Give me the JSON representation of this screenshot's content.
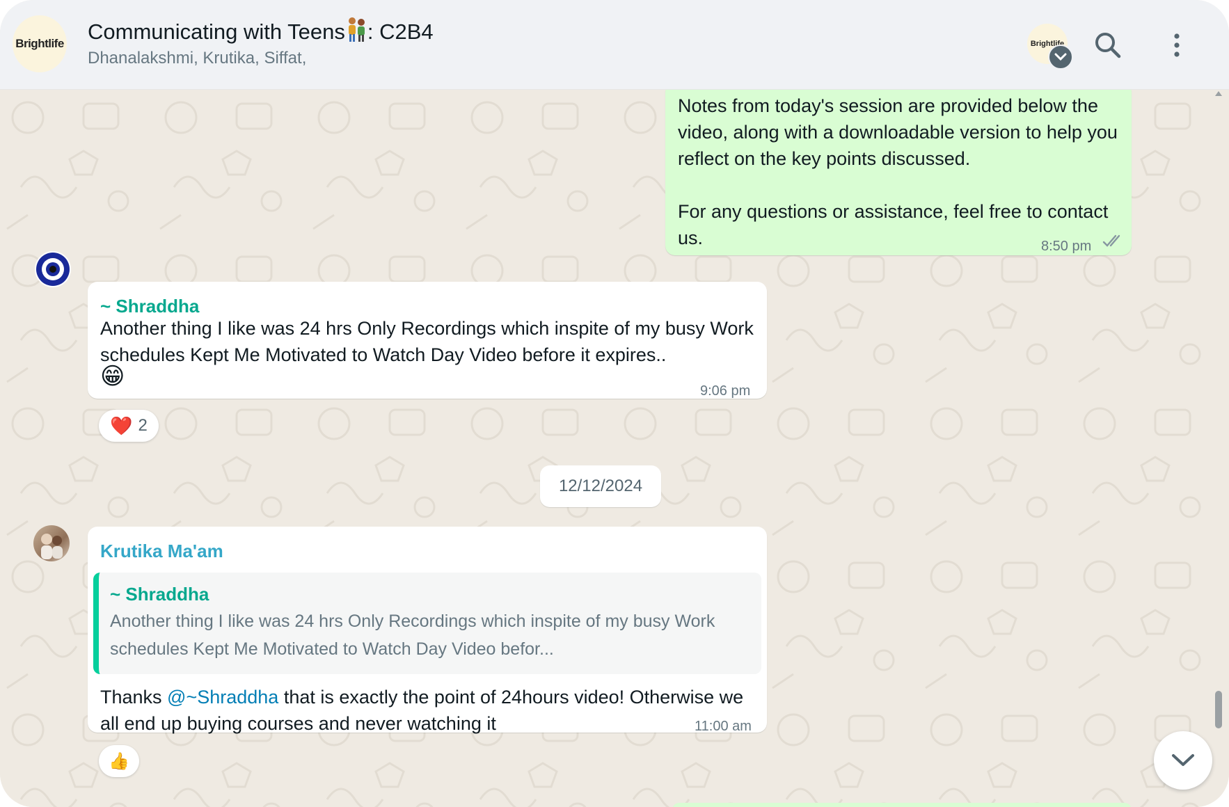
{
  "header": {
    "group_avatar_text": "Brightlife",
    "title_prefix": "Communicating with Teens",
    "title_suffix": ": C2B4",
    "subtitle": "Dhanalakshmi, Krutika, Siffat,",
    "icons": [
      "group-avatar",
      "search-icon",
      "menu-icon"
    ]
  },
  "messages": {
    "outgoing": {
      "text": "Notes from today's session are provided below the video, along with a downloadable version to help you reflect on the key points discussed.\n\nFor any questions or assistance, feel free to contact us.",
      "time": "8:50 pm",
      "status_icon": "double-check-icon"
    },
    "shraddha": {
      "sender": "~ Shraddha",
      "text": "Another thing I like was 24 hrs Only Recordings which inspite of my busy Work schedules Kept Me Motivated to Watch Day Video before it expires..",
      "emoji": "😁",
      "time": "9:06 pm",
      "reaction_emoji": "❤️",
      "reaction_count": "2"
    },
    "date_divider": "12/12/2024",
    "krutika": {
      "sender": "Krutika Ma'am",
      "quoted_sender": "~ Shraddha",
      "quoted_text": "Another thing I like was 24 hrs Only Recordings which inspite of my busy Work schedules Kept Me Motivated to Watch Day Video befor...",
      "text_before": "Thanks ",
      "mention": "@~Shraddha",
      "text_after": " that is exactly the point of 24hours video! Otherwise we all end up buying courses and never watching it",
      "time": "11:00 am",
      "reaction_emoji": "👍"
    }
  },
  "colors": {
    "header_bg": "#f0f2f5",
    "chat_bg": "#efeae2",
    "outgoing_bubble": "#d9fdd3",
    "incoming_bubble": "#ffffff",
    "sender_shraddha": "#06a88e",
    "sender_krutika": "#35a7c8",
    "mention": "#027eb5",
    "read_receipt": "#8696a0"
  }
}
